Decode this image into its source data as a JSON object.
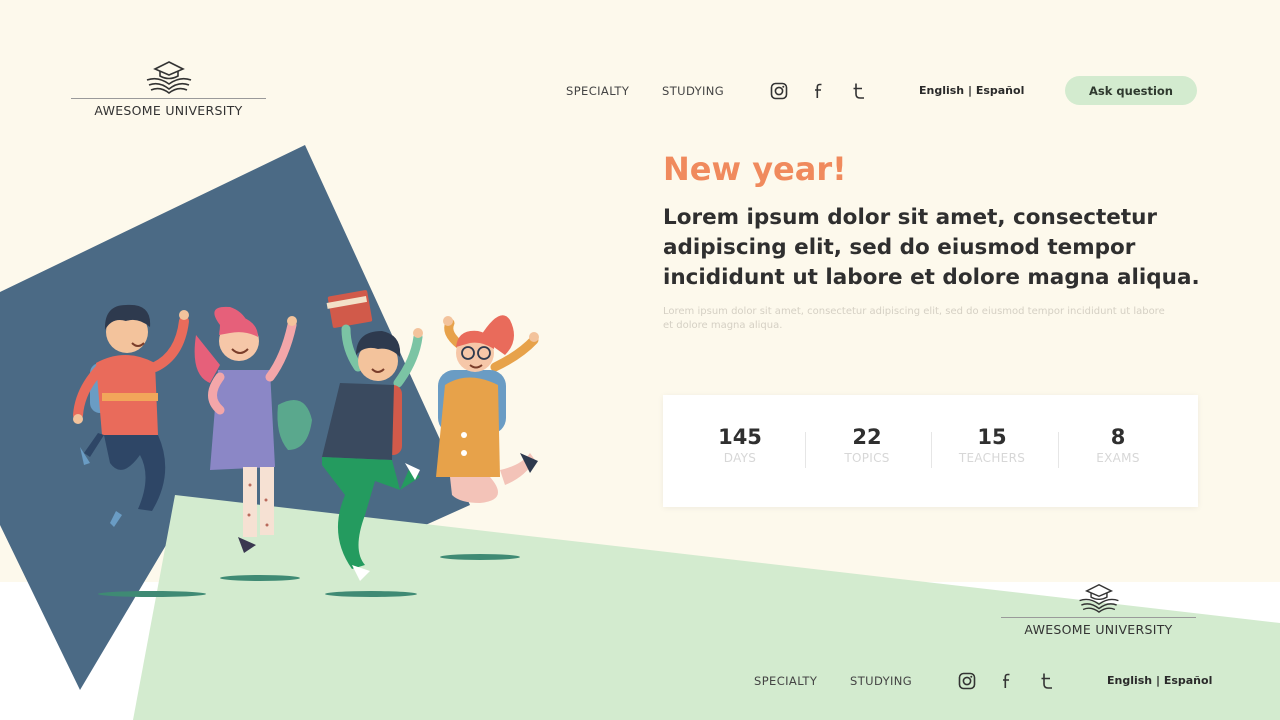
{
  "colors": {
    "cream": "#fdf9ec",
    "navy": "#4b6a85",
    "mint": "#d3ebcf",
    "accent": "#f08a5d",
    "text": "#2f2f2f"
  },
  "header": {
    "logo": {
      "icon": "graduation-cap-book-icon",
      "text": "AWESOME UNIVERSITY"
    },
    "nav": [
      "SPECIALTY",
      "STUDYING"
    ],
    "social_icons": [
      "instagram-icon",
      "facebook-icon",
      "twitter-icon"
    ],
    "lang": {
      "en": "English",
      "sep": " | ",
      "es": "Español"
    },
    "cta": "Ask question"
  },
  "hero": {
    "title": "New year!",
    "subtitle": "Lorem ipsum dolor sit amet, consectetur adipiscing elit, sed do eiusmod tempor incididunt ut labore et dolore magna aliqua.",
    "small": "Lorem ipsum dolor sit amet, consectetur adipiscing elit, sed do eiusmod tempor incididunt ut labore et dolore magna aliqua."
  },
  "stats": [
    {
      "value": "145",
      "label": "DAYS"
    },
    {
      "value": "22",
      "label": "TOPICS"
    },
    {
      "value": "15",
      "label": "TEACHERS"
    },
    {
      "value": "8",
      "label": "EXAMS"
    }
  ],
  "footer": {
    "logo_text": "AWESOME UNIVERSITY",
    "nav": [
      "SPECIALTY",
      "STUDYING"
    ],
    "lang": {
      "en": "English",
      "sep": " | ",
      "es": "Español"
    }
  }
}
